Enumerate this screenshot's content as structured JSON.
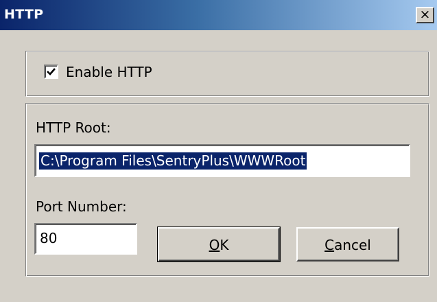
{
  "window": {
    "title": "HTTP",
    "close_glyph": "×"
  },
  "enable_group": {
    "checkbox_checked": true,
    "checkbox_label": "Enable HTTP"
  },
  "settings_group": {
    "root_label": "HTTP Root:",
    "root_value": "C:\\Program Files\\SentryPlus\\WWWRoot",
    "port_label": "Port Number:",
    "port_value": "80"
  },
  "buttons": {
    "ok": {
      "mnemonic": "O",
      "rest": "K"
    },
    "cancel": {
      "mnemonic": "C",
      "rest": "ancel"
    }
  },
  "colors": {
    "titlebar_start": "#0a246a",
    "titlebar_end": "#a6caf0",
    "dialog_face": "#d4d0c8",
    "selection": "#0a246a"
  },
  "icons": {
    "close": "close-icon",
    "check": "checkmark-icon"
  }
}
